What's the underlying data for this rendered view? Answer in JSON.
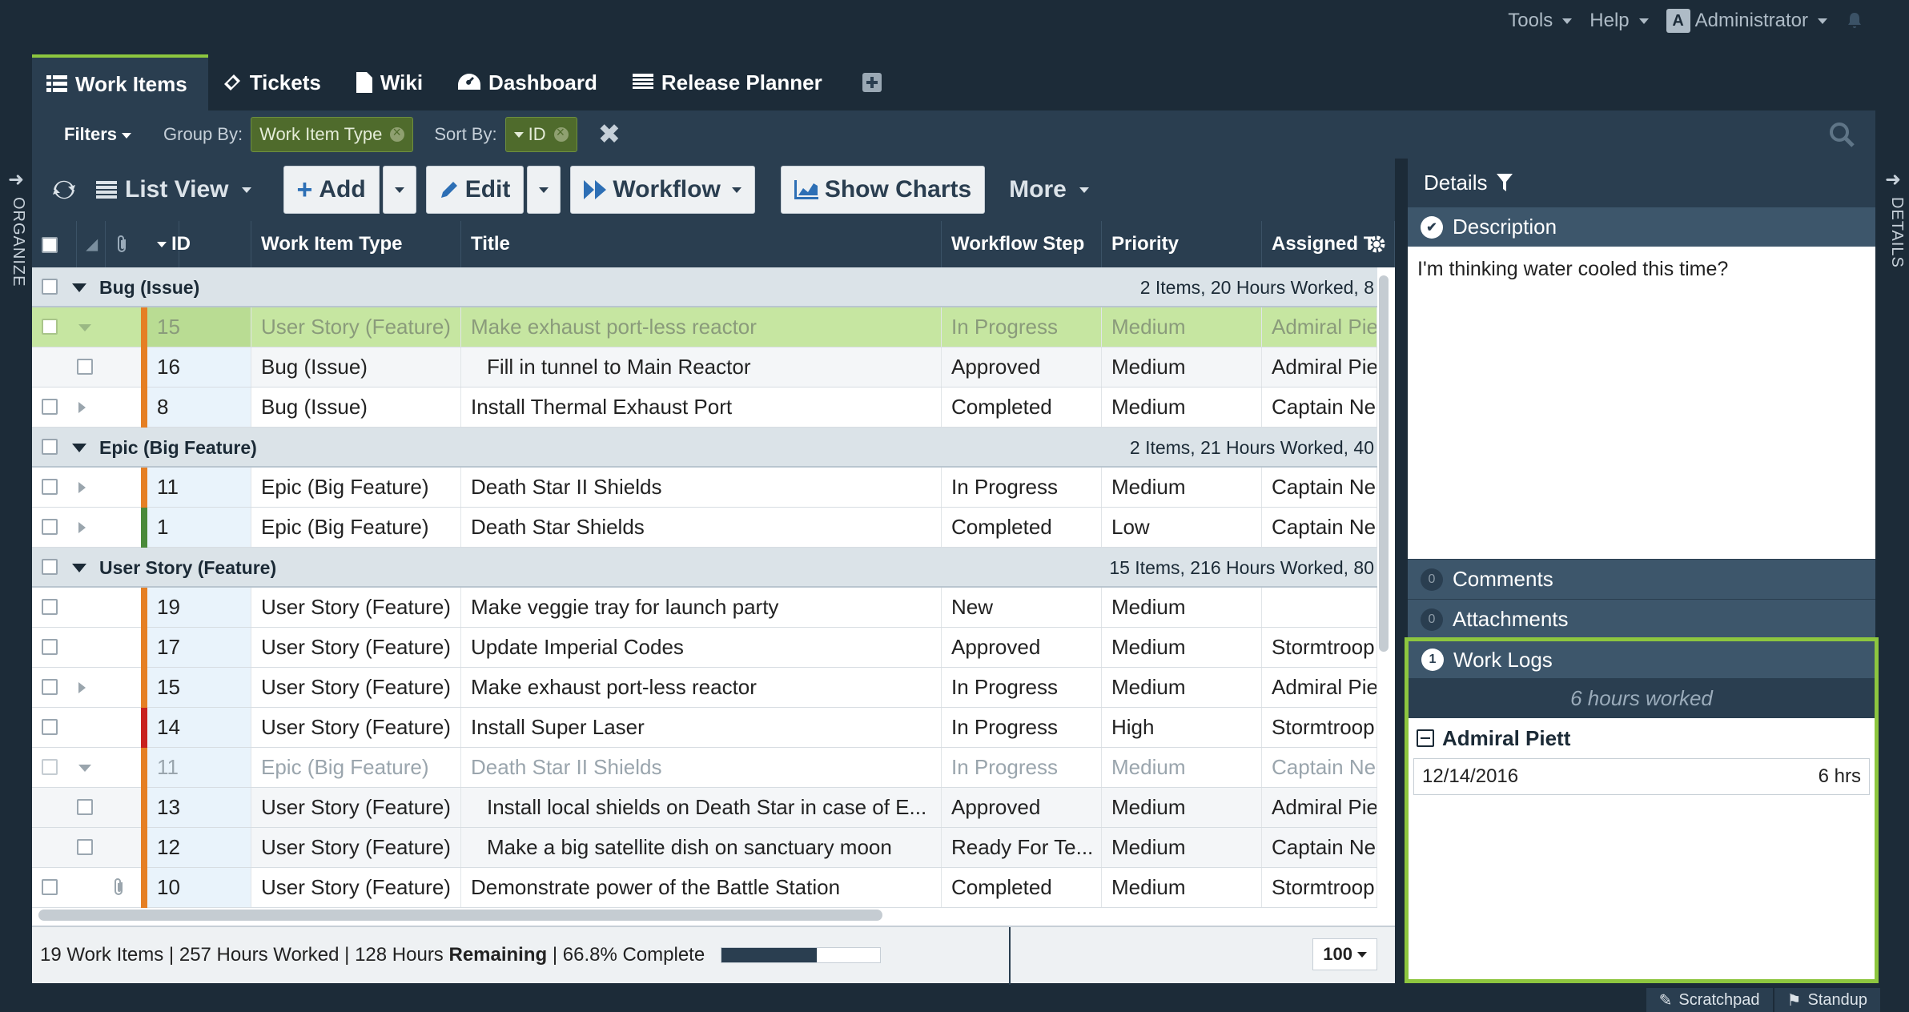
{
  "topmenu": {
    "tools": "Tools",
    "help": "Help",
    "avatar_letter": "A",
    "user": "Administrator",
    "bell_icon": "bell-icon"
  },
  "tabs": [
    {
      "label": "Work Items",
      "icon": "list-icon",
      "active": true
    },
    {
      "label": "Tickets",
      "icon": "ticket-icon",
      "active": false
    },
    {
      "label": "Wiki",
      "icon": "document-icon",
      "active": false
    },
    {
      "label": "Dashboard",
      "icon": "dashboard-icon",
      "active": false
    },
    {
      "label": "Release Planner",
      "icon": "calendar-icon",
      "active": false
    }
  ],
  "filters": {
    "label": "Filters",
    "group_by_label": "Group By:",
    "group_by_value": "Work Item Type",
    "sort_by_label": "Sort By:",
    "sort_by_value": "ID"
  },
  "toolbar": {
    "list_view": "List View",
    "add": "Add",
    "edit": "Edit",
    "workflow": "Workflow",
    "show_charts": "Show Charts",
    "more": "More"
  },
  "columns": [
    "ID",
    "Work Item Type",
    "Title",
    "Workflow Step",
    "Priority",
    "Assigned T"
  ],
  "groups": {
    "bug": {
      "name": "Bug (Issue)",
      "summary": "2 Items, 20 Hours Worked, 8"
    },
    "epic": {
      "name": "Epic (Big Feature)",
      "summary": "2 Items, 21 Hours Worked, 40"
    },
    "story": {
      "name": "User Story (Feature)",
      "summary": "15 Items, 216 Hours Worked, 80"
    }
  },
  "rows": [
    {
      "id": "15",
      "type": "User Story (Feature)",
      "title": "Make exhaust port-less reactor",
      "step": "In Progress",
      "priority": "Medium",
      "assigned": "Admiral Pie"
    },
    {
      "id": "16",
      "type": "Bug (Issue)",
      "title": "Fill in tunnel to Main Reactor",
      "step": "Approved",
      "priority": "Medium",
      "assigned": "Admiral Pie"
    },
    {
      "id": "8",
      "type": "Bug (Issue)",
      "title": "Install Thermal Exhaust Port",
      "step": "Completed",
      "priority": "Medium",
      "assigned": "Captain Ne"
    },
    {
      "id": "11",
      "type": "Epic (Big Feature)",
      "title": "Death Star II Shields",
      "step": "In Progress",
      "priority": "Medium",
      "assigned": "Captain Ne"
    },
    {
      "id": "1",
      "type": "Epic (Big Feature)",
      "title": "Death Star Shields",
      "step": "Completed",
      "priority": "Low",
      "assigned": "Captain Ne"
    },
    {
      "id": "19",
      "type": "User Story (Feature)",
      "title": "Make veggie tray for launch party",
      "step": "New",
      "priority": "Medium",
      "assigned": ""
    },
    {
      "id": "17",
      "type": "User Story (Feature)",
      "title": "Update Imperial Codes",
      "step": "Approved",
      "priority": "Medium",
      "assigned": "Stormtroop"
    },
    {
      "id": "15",
      "type": "User Story (Feature)",
      "title": "Make exhaust port-less reactor",
      "step": "In Progress",
      "priority": "Medium",
      "assigned": "Admiral Pie"
    },
    {
      "id": "14",
      "type": "User Story (Feature)",
      "title": "Install Super Laser",
      "step": "In Progress",
      "priority": "High",
      "assigned": "Stormtroop"
    },
    {
      "id": "11",
      "type": "Epic (Big Feature)",
      "title": "Death Star II Shields",
      "step": "In Progress",
      "priority": "Medium",
      "assigned": "Captain Ne"
    },
    {
      "id": "13",
      "type": "User Story (Feature)",
      "title": "Install local shields on Death Star in case of E...",
      "step": "Approved",
      "priority": "Medium",
      "assigned": "Admiral Pie"
    },
    {
      "id": "12",
      "type": "User Story (Feature)",
      "title": "Make a big satellite dish on sanctuary moon",
      "step": "Ready For Te...",
      "priority": "Medium",
      "assigned": "Captain Ne"
    },
    {
      "id": "10",
      "type": "User Story (Feature)",
      "title": "Demonstrate power of the Battle Station",
      "step": "Completed",
      "priority": "Medium",
      "assigned": "Stormtroop"
    }
  ],
  "footer": {
    "items": "19 Work Items",
    "worked": "257 Hours Worked",
    "remaining_num": "128 Hours",
    "remaining_label": "Remaining",
    "complete": "66.8% Complete",
    "progress": 0.6,
    "page_size": "100"
  },
  "details": {
    "title": "Details",
    "description_label": "Description",
    "description_text": "I'm thinking water cooled this time?",
    "comments_label": "Comments",
    "comments_count": "0",
    "attachments_label": "Attachments",
    "attachments_count": "0",
    "worklogs_label": "Work Logs",
    "worklogs_count": "1",
    "hours_worked": "6 hours worked",
    "log_user": "Admiral Piett",
    "log_date": "12/14/2016",
    "log_hours": "6 hrs"
  },
  "side": {
    "organize": "ORGANIZE",
    "details": "DETAILS"
  },
  "bottom": {
    "scratchpad": "Scratchpad",
    "standup": "Standup"
  },
  "colors": {
    "accent": "#8dc63f",
    "header": "#2a3e50",
    "orange": "#e57f24",
    "green": "#4a8a3a",
    "red": "#c8201e"
  }
}
